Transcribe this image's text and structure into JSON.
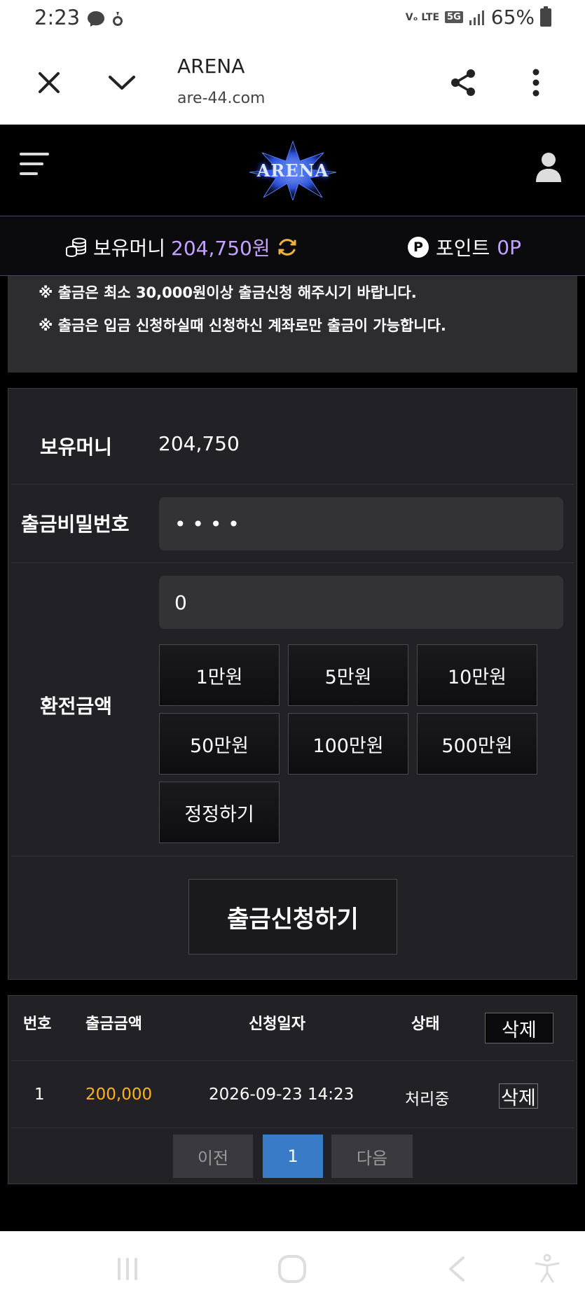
{
  "status_bar": {
    "time": "2:23",
    "network": "Vₒ LTE",
    "network_tag": "5G",
    "battery": "65%"
  },
  "browser": {
    "title": "ARENA",
    "url": "are-44.com"
  },
  "site": {
    "logo": "ARENA"
  },
  "wallet": {
    "money_label": "보유머니",
    "money_value": "204,750원",
    "points_label": "포인트",
    "points_value": "0P",
    "points_badge": "P"
  },
  "notice": {
    "lines": [
      "※ 출금은 최소 30,000원이상 출금신청 해주시기 바랍니다.",
      "※ 출금은 입금 신청하실때 신청하신 계좌로만 출금이 가능합니다."
    ]
  },
  "form": {
    "balance_label": "보유머니",
    "balance_value": "204,750",
    "password_label": "출금비밀번호",
    "password_value": "• • • •",
    "amount_label": "환전금액",
    "amount_value": "0",
    "amount_buttons": [
      "1만원",
      "5만원",
      "10만원",
      "50만원",
      "100만원",
      "500만원"
    ],
    "reset_button": "정정하기",
    "submit_button": "출금신청하기"
  },
  "history": {
    "headers": [
      "번호",
      "출금금액",
      "신청일자",
      "상태"
    ],
    "delete_all": "삭제",
    "rows": [
      {
        "no": "1",
        "amount": "200,000",
        "date": "2026-09-23 14:23",
        "status": "처리중",
        "delete": "삭제"
      }
    ],
    "pagination": {
      "prev": "이전",
      "current": "1",
      "next": "다음"
    }
  },
  "colors": {
    "accent_purple": "#c3a3ff",
    "amount_orange": "#ffb21e",
    "page_active": "#3a7bc8"
  }
}
